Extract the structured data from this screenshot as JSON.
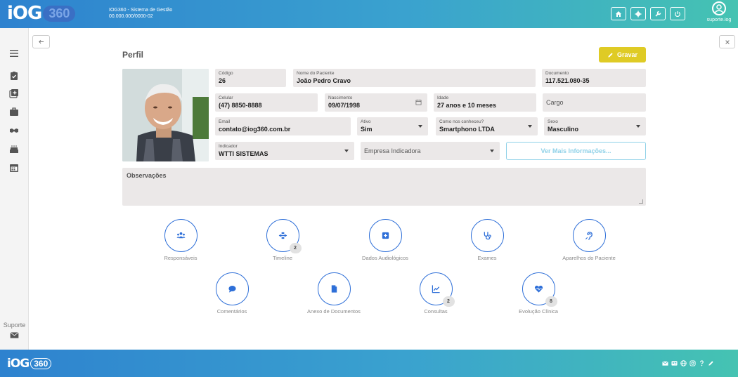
{
  "app": {
    "logo_text": "iOG",
    "logo_badge": "360",
    "system_name": "IOG360 - Sistema de Gestão",
    "cnpj": "00.000.000/0000-02",
    "username": "suporte.iog"
  },
  "sidebar": {
    "support_label": "Suporte"
  },
  "page": {
    "title": "Perfil",
    "save_label": "Gravar"
  },
  "form": {
    "codigo": {
      "label": "Código",
      "value": "26"
    },
    "nome": {
      "label": "Nome do Paciente",
      "value": "João Pedro Cravo"
    },
    "documento": {
      "label": "Documento",
      "value": "117.521.080-35"
    },
    "celular": {
      "label": "Celular",
      "value": "(47) 8850-8888"
    },
    "nascimento": {
      "label": "Nascimento",
      "value": "09/07/1998"
    },
    "idade": {
      "label": "Idade",
      "value": "27 anos e 10 meses"
    },
    "cargo": {
      "placeholder": "Cargo"
    },
    "email": {
      "label": "Email",
      "value": "contato@iog360.com.br"
    },
    "ativo": {
      "label": "Ativo",
      "value": "Sim"
    },
    "como_conheceu": {
      "label": "Como nos conheceu?",
      "value": "Smartphono LTDA"
    },
    "sexo": {
      "label": "Sexo",
      "value": "Masculino"
    },
    "indicador": {
      "label": "Indicador",
      "value": "WTTI SISTEMAS"
    },
    "empresa_indicadora": {
      "placeholder": "Empresa Indicadora"
    },
    "more_info_label": "Ver Mais Informações...",
    "observacoes_placeholder": "Observações"
  },
  "actions": [
    {
      "label": "Responsáveis",
      "icon": "users-icon",
      "badge": ""
    },
    {
      "label": "Timeline",
      "icon": "timeline-icon",
      "badge": "2"
    },
    {
      "label": "Dados Audiológicos",
      "icon": "plus-square-icon",
      "badge": ""
    },
    {
      "label": "Exames",
      "icon": "stethoscope-icon",
      "badge": ""
    },
    {
      "label": "Aparelhos do Paciente",
      "icon": "hearing-icon",
      "badge": ""
    },
    {
      "label": "Comentários",
      "icon": "comment-icon",
      "badge": ""
    },
    {
      "label": "Anexo de Documentos",
      "icon": "file-icon",
      "badge": ""
    },
    {
      "label": "Consultas",
      "icon": "chart-line-icon",
      "badge": "2"
    },
    {
      "label": "Evolução Clínica",
      "icon": "heartbeat-icon",
      "badge": "8"
    }
  ],
  "footer": {
    "logo_text": "iOG",
    "logo_badge": "360",
    "icons": [
      "envelope-icon",
      "id-card-icon",
      "globe-icon",
      "instagram-icon",
      "question-icon",
      "pencil-icon"
    ]
  },
  "colors": {
    "accent_blue": "#2e6fd8",
    "save_yellow": "#dfcb25",
    "field_bg": "#ebe8e8",
    "outline_cyan": "#8fd1e8"
  }
}
